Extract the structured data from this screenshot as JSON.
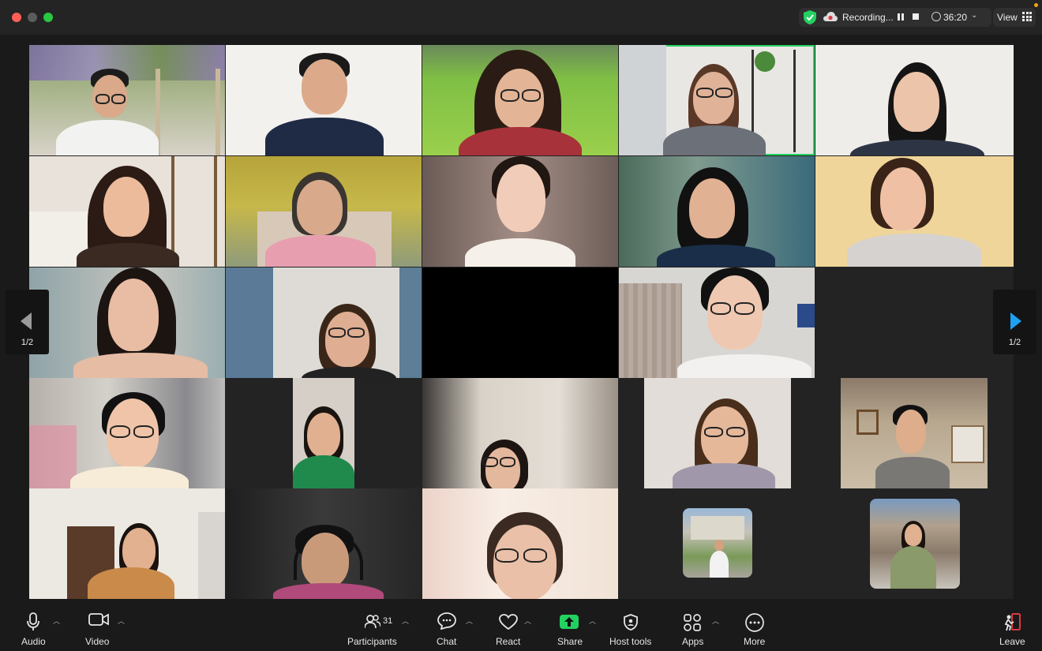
{
  "titlebar": {
    "recording_label": "Recording...",
    "timer": "36:20",
    "view_label": "View"
  },
  "pager": {
    "left_page": "1/2",
    "right_page": "1/2"
  },
  "toolbar": {
    "audio_label": "Audio",
    "video_label": "Video",
    "participants_label": "Participants",
    "participants_count": "31",
    "chat_label": "Chat",
    "react_label": "React",
    "share_label": "Share",
    "host_tools_label": "Host tools",
    "apps_label": "Apps",
    "more_label": "More",
    "leave_label": "Leave"
  },
  "colors": {
    "active_speaker_border": "#23d160",
    "share_green": "#23d160",
    "leave_red": "#e0383e",
    "pager_arrow_blue": "#1da1f2"
  },
  "icons": [
    "security-shield-icon",
    "cloud-recording-icon",
    "pause-icon",
    "stop-icon",
    "clock-icon",
    "view-grid-icon",
    "microphone-icon",
    "camera-icon",
    "participants-icon",
    "chat-icon",
    "heart-icon",
    "share-up-arrow-icon",
    "shield-icon",
    "apps-icon",
    "ellipsis-icon",
    "leave-icon"
  ]
}
